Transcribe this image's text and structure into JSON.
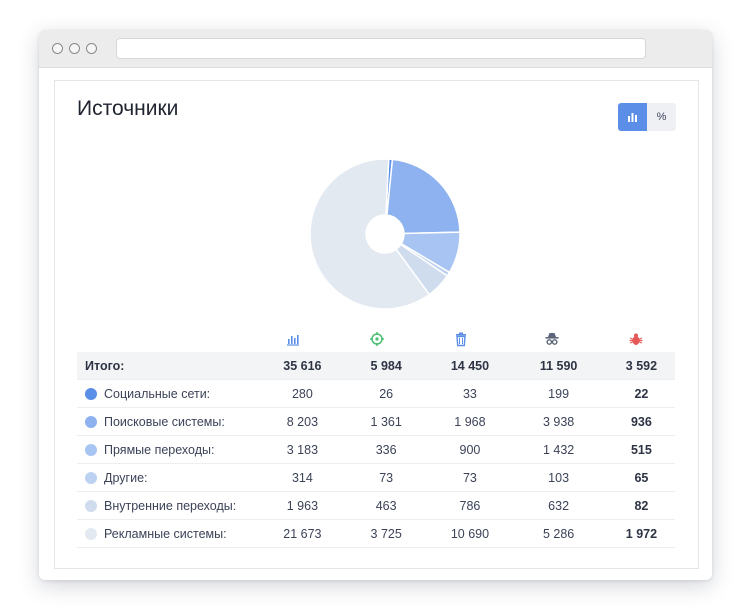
{
  "panel": {
    "title": "Источники",
    "toggle": {
      "percent_label": "%"
    }
  },
  "columns": [
    {
      "icon": "bar-chart-icon",
      "color": "#5b8ee6"
    },
    {
      "icon": "target-icon",
      "color": "#4cbf73"
    },
    {
      "icon": "trash-icon",
      "color": "#5b8ee6"
    },
    {
      "icon": "spy-icon",
      "color": "#5b6478"
    },
    {
      "icon": "bug-icon",
      "color": "#e45858"
    }
  ],
  "table": {
    "total": {
      "label": "Итого:",
      "values": [
        "35 616",
        "5 984",
        "14 450",
        "11 590",
        "3 592"
      ]
    },
    "rows": [
      {
        "label": "Социальные сети:",
        "color": "#5b8ee6",
        "values": [
          "280",
          "26",
          "33",
          "199",
          "22"
        ]
      },
      {
        "label": "Поисковые системы:",
        "color": "#8db2ef",
        "values": [
          "8 203",
          "1 361",
          "1 968",
          "3 938",
          "936"
        ]
      },
      {
        "label": "Прямые переходы:",
        "color": "#a8c4f2",
        "values": [
          "3 183",
          "336",
          "900",
          "1 432",
          "515"
        ]
      },
      {
        "label": "Другие:",
        "color": "#bdd1f1",
        "values": [
          "314",
          "73",
          "73",
          "103",
          "65"
        ]
      },
      {
        "label": "Внутренние переходы:",
        "color": "#cfdcee",
        "values": [
          "1 963",
          "463",
          "786",
          "632",
          "82"
        ]
      },
      {
        "label": "Рекламные системы:",
        "color": "#e3e9f1",
        "values": [
          "21 673",
          "3 725",
          "10 690",
          "5 286",
          "1 972"
        ]
      }
    ]
  },
  "chart_data": {
    "type": "pie",
    "donut": true,
    "slices": [
      {
        "category": "Социальные сети",
        "value": 280,
        "color": "#5b8ee6"
      },
      {
        "category": "Поисковые системы",
        "value": 8203,
        "color": "#8db2ef"
      },
      {
        "category": "Прямые переходы",
        "value": 3183,
        "color": "#a8c4f2"
      },
      {
        "category": "Другие",
        "value": 314,
        "color": "#bdd1f1"
      },
      {
        "category": "Внутренние переходы",
        "value": 1963,
        "color": "#cfdcee"
      },
      {
        "category": "Рекламные системы",
        "value": 21673,
        "color": "#e3e9f1"
      }
    ]
  }
}
